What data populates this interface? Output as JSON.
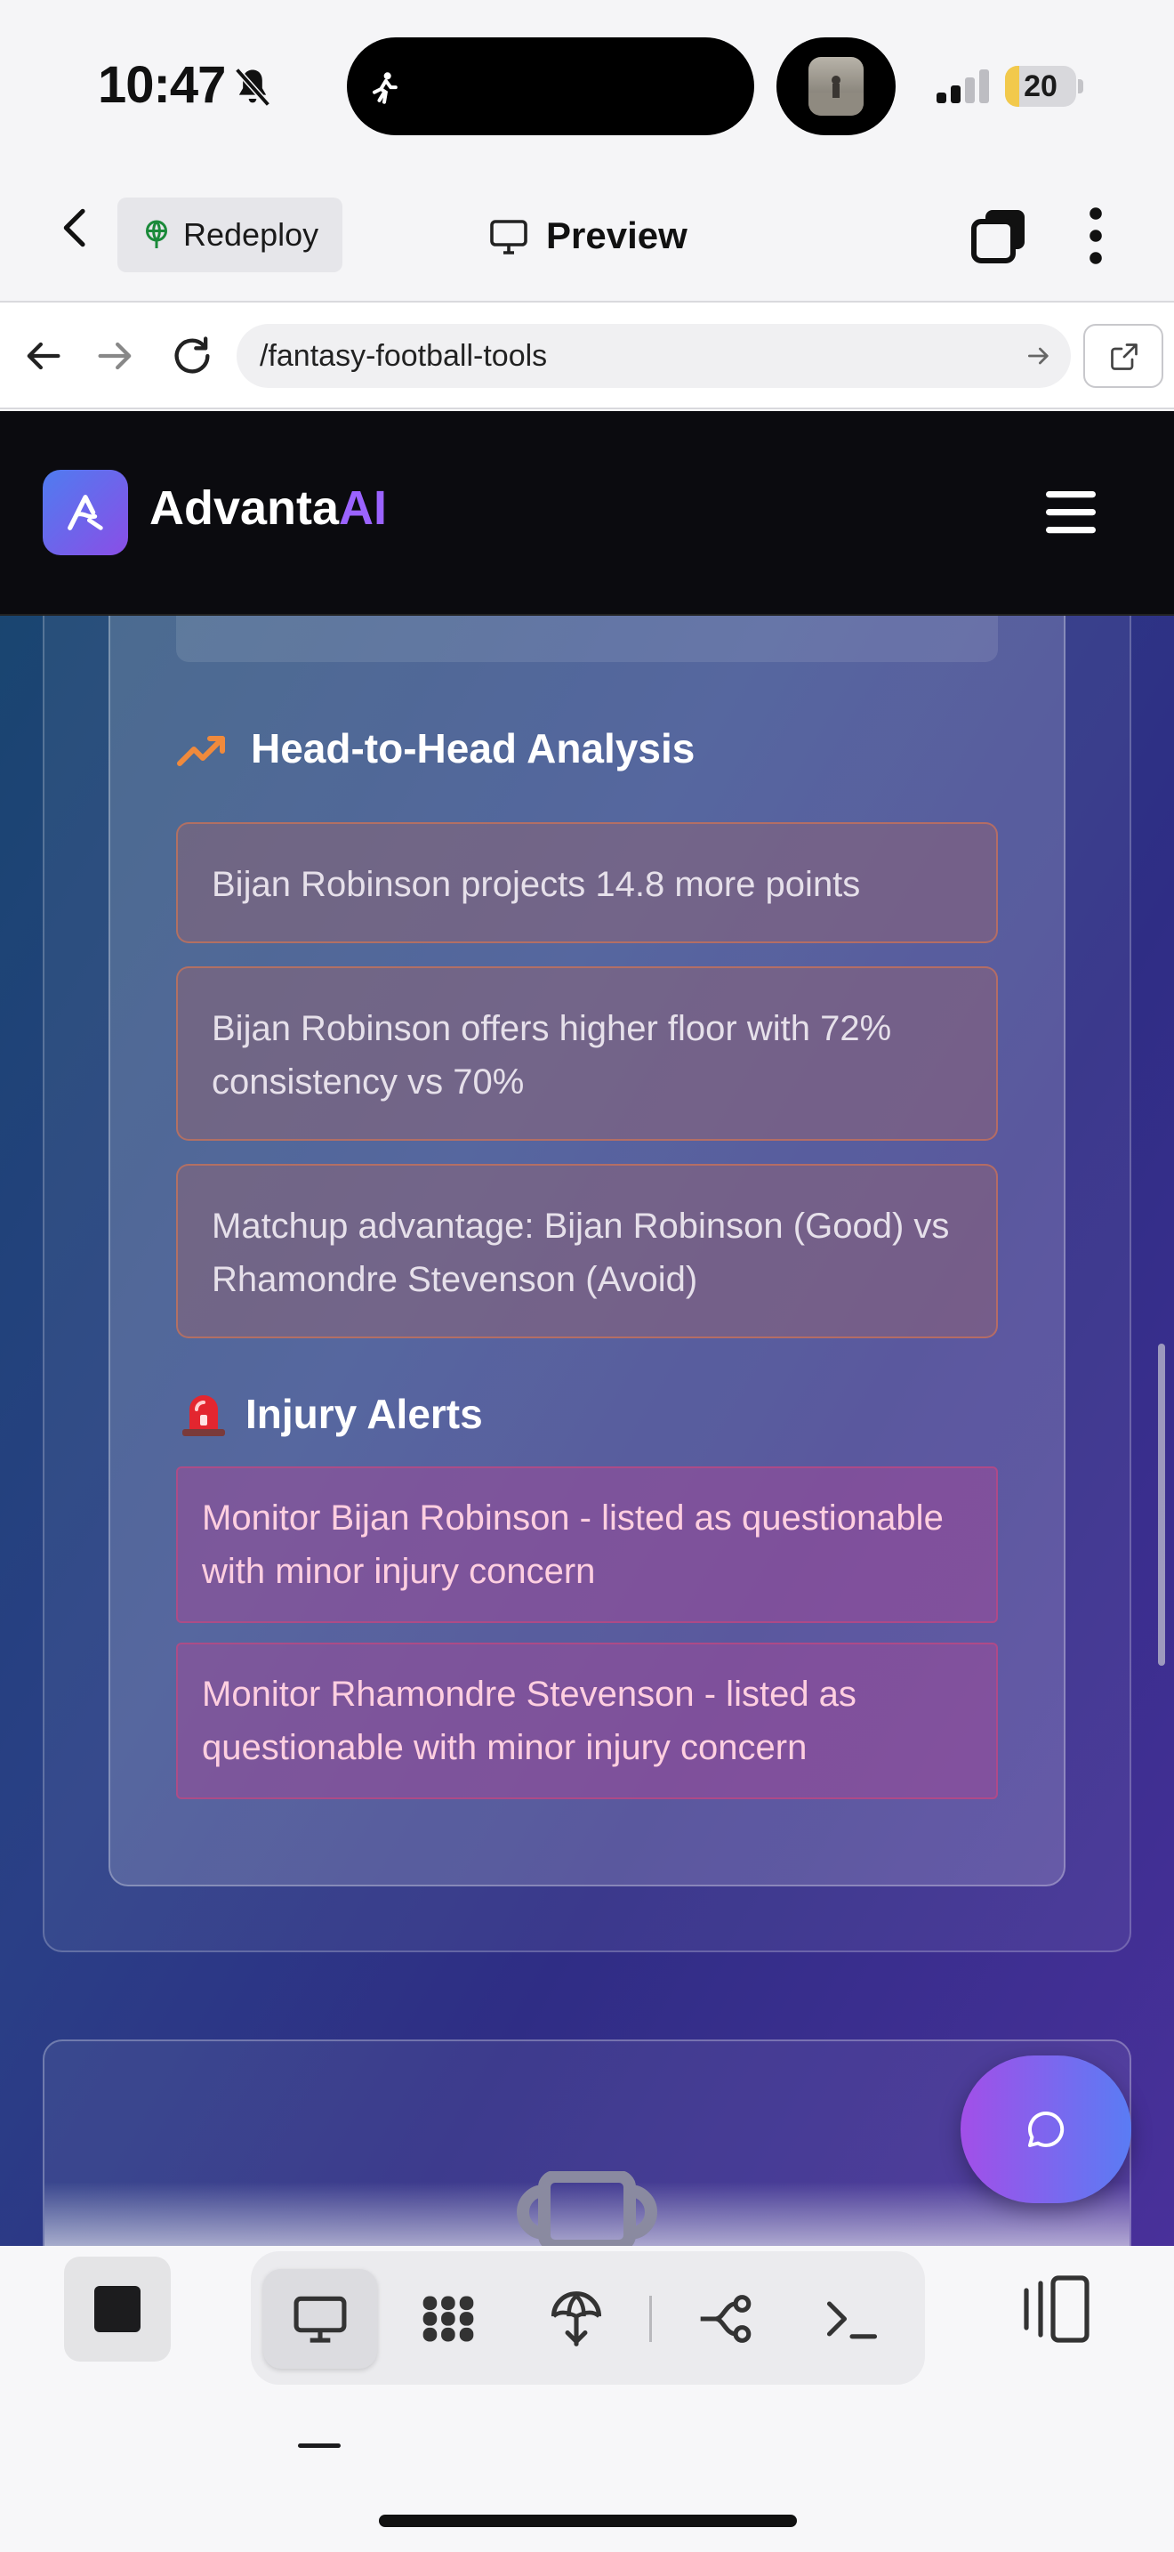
{
  "status_bar": {
    "time": "10:47",
    "battery_level": "20",
    "battery_fraction": 0.2,
    "icons": [
      "bell-slash-icon",
      "runner-icon",
      "album-art",
      "signal-icon",
      "battery-icon"
    ]
  },
  "app_header": {
    "back_icon": "chevron-left-icon",
    "redeploy_label": "Redeploy",
    "redeploy_icon": "globe-icon",
    "preview_label": "Preview",
    "preview_icon": "monitor-icon",
    "tabs_icon": "tabs-icon",
    "more_icon": "vertical-ellipsis-icon"
  },
  "url_bar": {
    "url": "/fantasy-football-tools",
    "back_icon": "arrow-left-icon",
    "forward_icon": "arrow-right-icon",
    "reload_icon": "reload-icon",
    "go_icon": "arrow-right-small-icon",
    "external_icon": "external-link-icon"
  },
  "site": {
    "brand_main": "Advanta",
    "brand_accent": "AI",
    "accent_color": "#9b63ff",
    "menu_icon": "hamburger-icon"
  },
  "head_to_head": {
    "title": "Head-to-Head Analysis",
    "icon": "trending-up-icon",
    "items": [
      "Bijan Robinson projects 14.8 more points",
      "Bijan Robinson offers higher floor with 72% consistency vs 70%",
      "Matchup advantage: Bijan Robinson (Good) vs Rhamondre Stevenson (Avoid)"
    ]
  },
  "injury_alerts": {
    "title": "Injury Alerts",
    "icon": "siren-icon",
    "items": [
      "Monitor Bijan Robinson - listed as questionable with minor injury concern",
      "Monitor Rhamondre Stevenson - listed as questionable with minor injury concern"
    ]
  },
  "chat_button_icon": "chat-bubble-icon",
  "bottom_toolbar": {
    "stop_icon": "stop-icon",
    "tools": [
      "monitor-icon",
      "grid-icon",
      "deploy-icon",
      "branch-icon",
      "terminal-icon"
    ],
    "active_tool": "monitor-icon",
    "panel_icon": "panel-toggle-icon"
  }
}
